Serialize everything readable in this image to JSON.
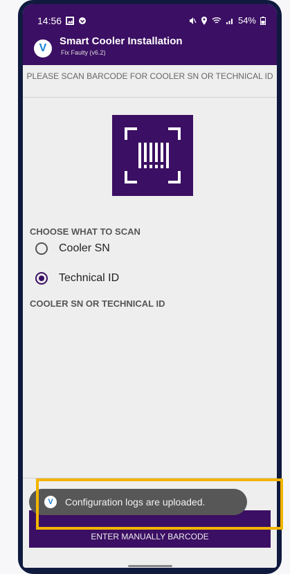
{
  "status_bar": {
    "time": "14:56",
    "battery": "54%"
  },
  "header": {
    "title": "Smart Cooler Installation",
    "subtitle": "Fix Faulty (v6.2)"
  },
  "instruction": "PLEASE SCAN BARCODE FOR COOLER SN OR TECHNICAL ID",
  "choose_label": "CHOOSE WHAT TO SCAN",
  "options": [
    {
      "label": "Cooler SN",
      "selected": false
    },
    {
      "label": "Technical ID",
      "selected": true
    }
  ],
  "field_label": "COOLER SN OR TECHNICAL ID",
  "enter_button_label": "ENTER MANUALLY BARCODE",
  "toast": {
    "message": "Configuration logs are uploaded."
  },
  "colors": {
    "primary": "#3b0f63",
    "highlight": "#f3b400"
  }
}
